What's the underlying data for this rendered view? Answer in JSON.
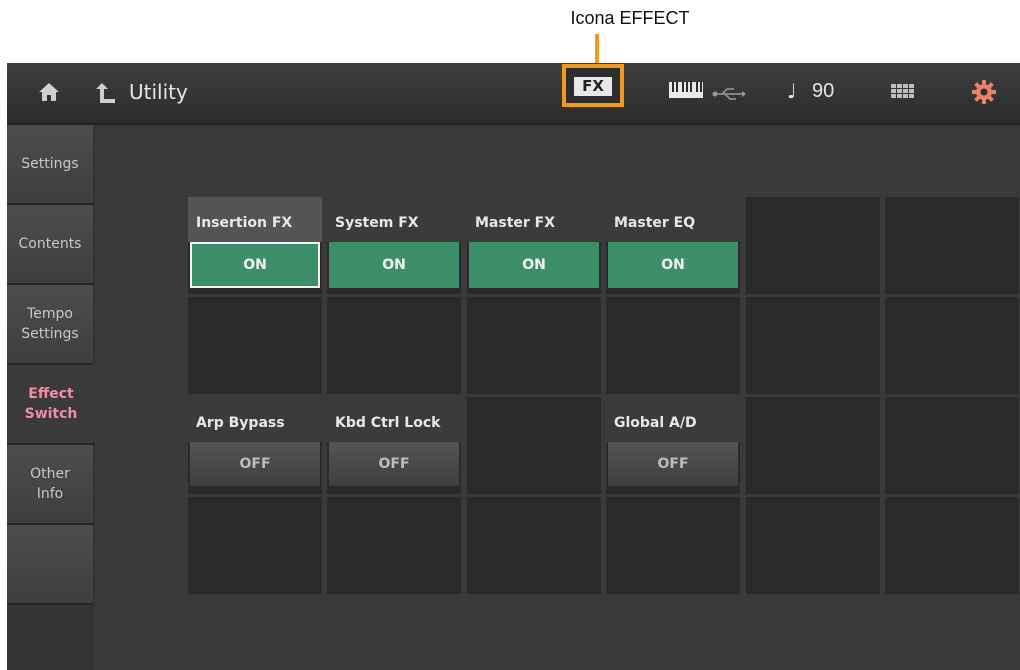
{
  "callout": {
    "label": "Icona EFFECT",
    "color": "#f29a1e"
  },
  "titlebar": {
    "home_icon": "home-icon",
    "up_icon": "up-arrow-icon",
    "title": "Utility",
    "fx_icon": "FX",
    "note_icon": "♩",
    "tempo": "90",
    "grid_icon": "grid-icon",
    "settings_icon": "gear-icon"
  },
  "sidebar": {
    "tabs": [
      {
        "label": "Settings",
        "active": false
      },
      {
        "label": "Contents",
        "active": false
      },
      {
        "label": "Tempo\nSettings",
        "active": false
      },
      {
        "label": "Effect\nSwitch",
        "active": true
      },
      {
        "label": "Other\nInfo",
        "active": false
      },
      {
        "label": "",
        "active": false
      }
    ]
  },
  "switches": [
    {
      "label": "Insertion FX",
      "value": "ON",
      "state": "on",
      "selected": true
    },
    {
      "label": "System FX",
      "value": "ON",
      "state": "on",
      "selected": false
    },
    {
      "label": "Master FX",
      "value": "ON",
      "state": "on",
      "selected": false
    },
    {
      "label": "Master EQ",
      "value": "ON",
      "state": "on",
      "selected": false
    },
    {
      "label": "Arp Bypass",
      "value": "OFF",
      "state": "off",
      "selected": false
    },
    {
      "label": "Kbd Ctrl Lock",
      "value": "OFF",
      "state": "off",
      "selected": false
    },
    {
      "label": "Global A/D",
      "value": "OFF",
      "state": "off",
      "selected": false
    }
  ],
  "colors": {
    "on": "#3d8f6a",
    "active_tab": "#f08ca6"
  }
}
